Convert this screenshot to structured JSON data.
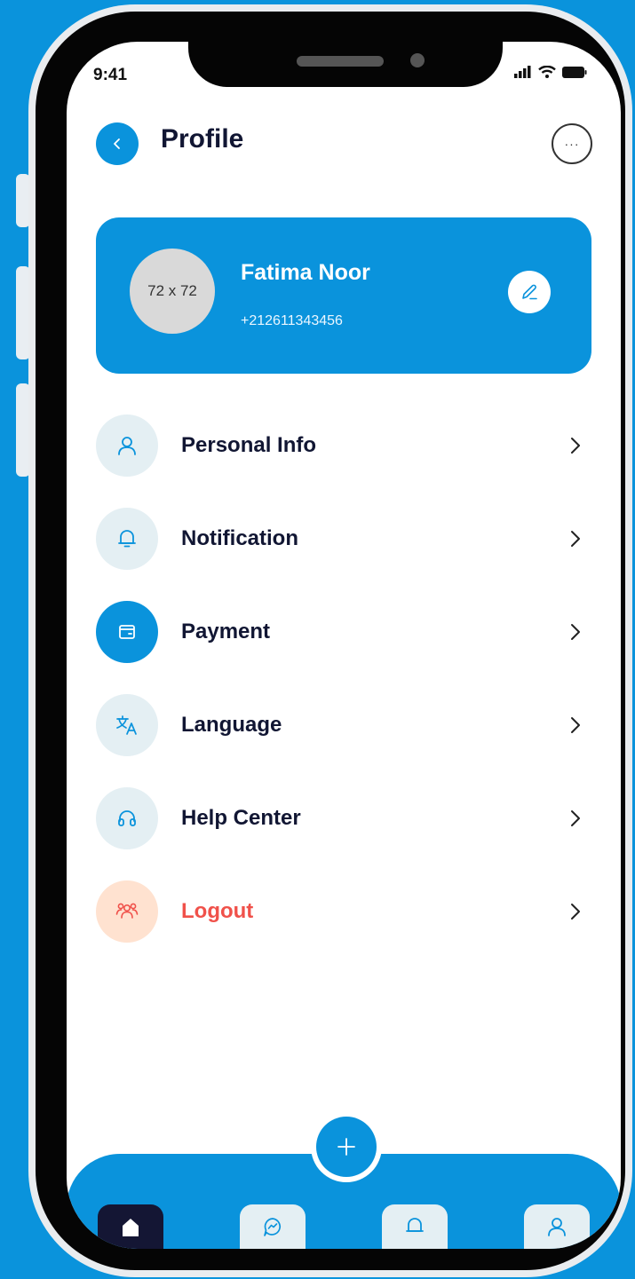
{
  "status_bar": {
    "time": "9:41"
  },
  "header": {
    "title": "Profile"
  },
  "profile": {
    "avatar_placeholder": "72 x 72",
    "name": "Fatima Noor",
    "phone": "+212611343456"
  },
  "menu": [
    {
      "label": "Personal Info",
      "icon": "user-icon"
    },
    {
      "label": "Notification",
      "icon": "bell-icon"
    },
    {
      "label": "Payment",
      "icon": "wallet-icon"
    },
    {
      "label": "Language",
      "icon": "translate-icon"
    },
    {
      "label": "Help Center",
      "icon": "headset-icon"
    },
    {
      "label": "Logout",
      "icon": "logout-icon"
    }
  ],
  "bottom_nav": [
    "home-icon",
    "chat-icon",
    "bell-icon",
    "user-icon"
  ],
  "colors": {
    "accent": "#0a93dc",
    "text_dark": "#111633",
    "logout_red": "#f0514a",
    "logout_icon_bg": "#ffe2d0",
    "icon_bg": "#e4eff3"
  }
}
